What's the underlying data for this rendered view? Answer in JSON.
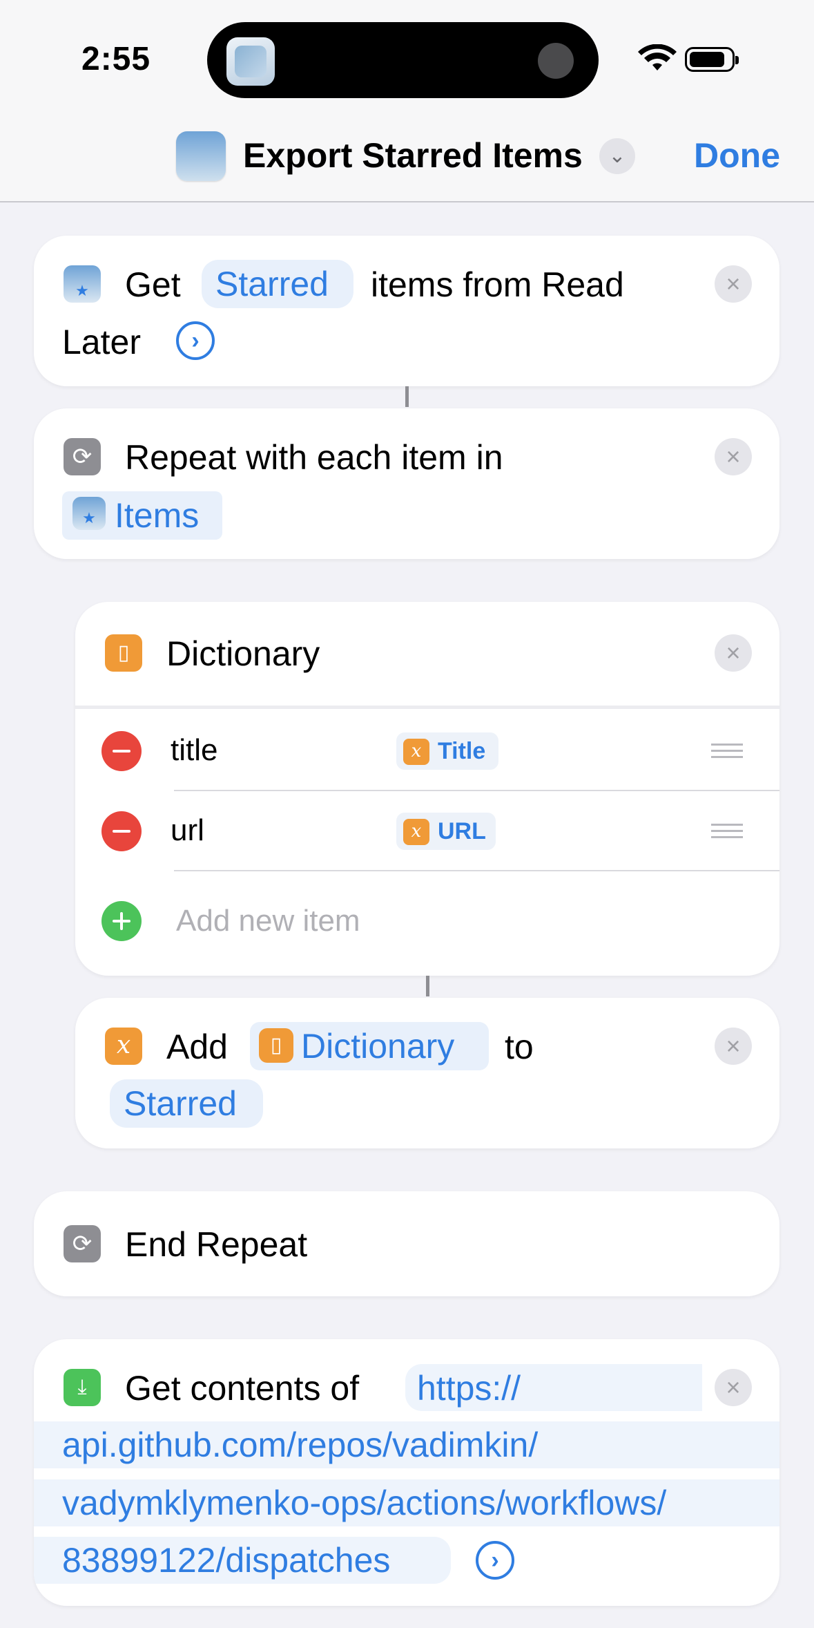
{
  "status_bar": {
    "time": "2:55"
  },
  "nav": {
    "title": "Export Starred Items",
    "done_label": "Done"
  },
  "actions": {
    "get_items": {
      "verb": "Get",
      "filter_token": "Starred",
      "text_1": "items from Read",
      "text_2": "Later"
    },
    "repeat": {
      "text": "Repeat with each item in",
      "input_token": "Items"
    },
    "dictionary": {
      "title": "Dictionary",
      "rows": [
        {
          "key": "title",
          "value": "Title"
        },
        {
          "key": "url",
          "value": "URL"
        }
      ],
      "add_placeholder": "Add new item"
    },
    "add_variable": {
      "verb": "Add",
      "input_token": "Dictionary",
      "connector": "to",
      "variable_token": "Starred"
    },
    "end_repeat": {
      "text": "End Repeat"
    },
    "get_contents": {
      "text": "Get contents of",
      "url_lines": [
        "https://",
        "api.github.com/repos/vadimkin/",
        "vadymklymenko-ops/actions/workflows/",
        "83899122/dispatches"
      ]
    }
  },
  "colors": {
    "accent": "#2f7de1",
    "background": "#f2f2f7",
    "card": "#ffffff",
    "destructive": "#e8453c",
    "add": "#4cc35a",
    "dictionary": "#f09a37",
    "control_flow": "#8e8e93"
  }
}
